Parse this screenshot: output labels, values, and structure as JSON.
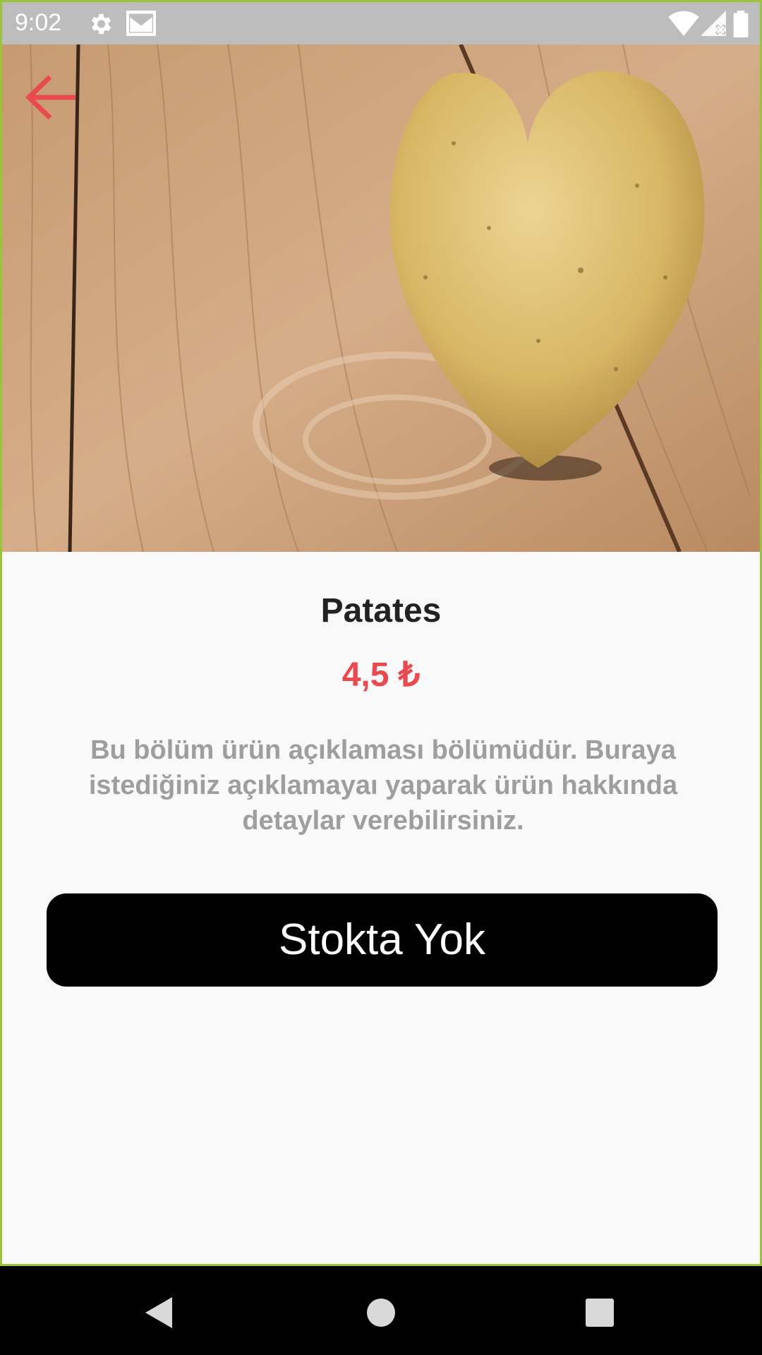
{
  "status_bar": {
    "time": "9:02",
    "left_icons": [
      "gear-icon",
      "mail-icon"
    ],
    "right_icons": [
      "wifi-icon",
      "signal-icon",
      "battery-icon"
    ]
  },
  "product": {
    "name": "Patates",
    "price": "4,5 ₺",
    "description": "Bu bölüm ürün açıklaması bölümüdür. Buraya istediğiniz açıklamayaı yaparak ürün hakkında detaylar verebilirsiniz.",
    "stock_button_label": "Stokta Yok"
  },
  "colors": {
    "accent": "#e84a4f",
    "button_bg": "#000000",
    "description_text": "#9e9e9e",
    "title_text": "#222222",
    "frame_border": "#9ac43c"
  },
  "nav_bar": {
    "buttons": [
      "back-triangle-icon",
      "home-circle-icon",
      "recents-square-icon"
    ]
  }
}
